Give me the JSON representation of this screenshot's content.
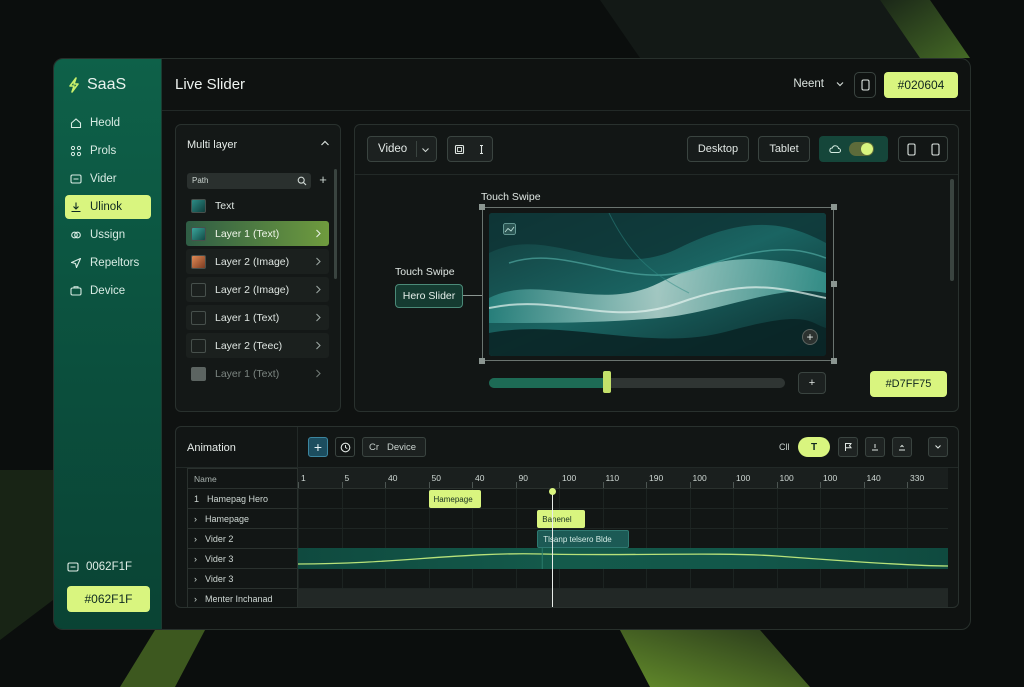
{
  "brand": {
    "name": "SaaS"
  },
  "sidebar": {
    "items": [
      {
        "label": "Heold",
        "icon": "home-icon"
      },
      {
        "label": "Prols",
        "icon": "grid-icon"
      },
      {
        "label": "Vider",
        "icon": "video-icon"
      },
      {
        "label": "Ulinok",
        "icon": "upload-icon",
        "active": true
      },
      {
        "label": "Ussign",
        "icon": "link-icon"
      },
      {
        "label": "Repeltors",
        "icon": "send-icon"
      },
      {
        "label": "Device",
        "icon": "device-icon"
      }
    ],
    "footer_label": "0062F1F",
    "footer_button": "#062F1F"
  },
  "header": {
    "title": "Live Slider",
    "user_menu": "Neent",
    "hex_button": "#020604"
  },
  "layer_panel": {
    "title": "Multi layer",
    "search_value": "Path",
    "layers": [
      {
        "label": "Text",
        "thumb": "teal",
        "style": "plain",
        "chevron": false
      },
      {
        "label": "Layer 1 (Text)",
        "thumb": "teal",
        "style": "active",
        "chevron": true
      },
      {
        "label": "Layer 2 (Image)",
        "thumb": "orange",
        "style": "normal",
        "chevron": true
      },
      {
        "label": "Layer 2 (Image)",
        "thumb": "empty",
        "style": "normal",
        "chevron": true
      },
      {
        "label": "Layer 1 (Text)",
        "thumb": "empty",
        "style": "normal",
        "chevron": true
      },
      {
        "label": "Layer 2 (Teec)",
        "thumb": "empty",
        "style": "normal",
        "chevron": true
      },
      {
        "label": "Layer 1 (Text)",
        "thumb": "grey",
        "style": "dim",
        "chevron": true
      }
    ]
  },
  "preview": {
    "video_select": "Video",
    "desktop_label": "Desktop",
    "tablet_label": "Tablet",
    "touch_swipe_top": "Touch Swipe",
    "touch_swipe_left": "Touch Swipe",
    "hero_chip": "Hero Slider",
    "slider_plus": "+",
    "slider_value": 0.4,
    "hex_chip": "#D7FF75"
  },
  "animation": {
    "title": "Animation",
    "device_tab": "Device",
    "device_prefix": "Cr",
    "toolbar_label": "Cll",
    "toolbar_t": "T",
    "name_header": "Name",
    "tracks": [
      {
        "arrow": "1",
        "label": "Hamepag Hero"
      },
      {
        "arrow": "›",
        "label": "Hamepage"
      },
      {
        "arrow": "›",
        "label": "Vider 2"
      },
      {
        "arrow": "›",
        "label": "Vider 3"
      },
      {
        "arrow": "›",
        "label": "Vider 3"
      },
      {
        "arrow": "›",
        "label": "Menter Inchanad"
      }
    ],
    "ruler": [
      "1",
      "5",
      "40",
      "50",
      "40",
      "90",
      "100",
      "110",
      "190",
      "100",
      "100",
      "100",
      "100",
      "140",
      "330"
    ],
    "keyframes": [
      {
        "label": "Hamepage",
        "row": 0,
        "start": 3,
        "end": 4.2,
        "color": "lime"
      },
      {
        "label": "Banenel",
        "row": 1,
        "start": 5.5,
        "end": 6.6,
        "color": "lime"
      },
      {
        "label": "Tlsanp telsero Blde",
        "row": 2,
        "start": 5.5,
        "end": 7.6,
        "color": "teal"
      }
    ],
    "playhead_position": 5.85
  },
  "colors": {
    "accent": "#D9F57F",
    "sidebar": "#0E6149",
    "teal": "#1C5A55"
  }
}
